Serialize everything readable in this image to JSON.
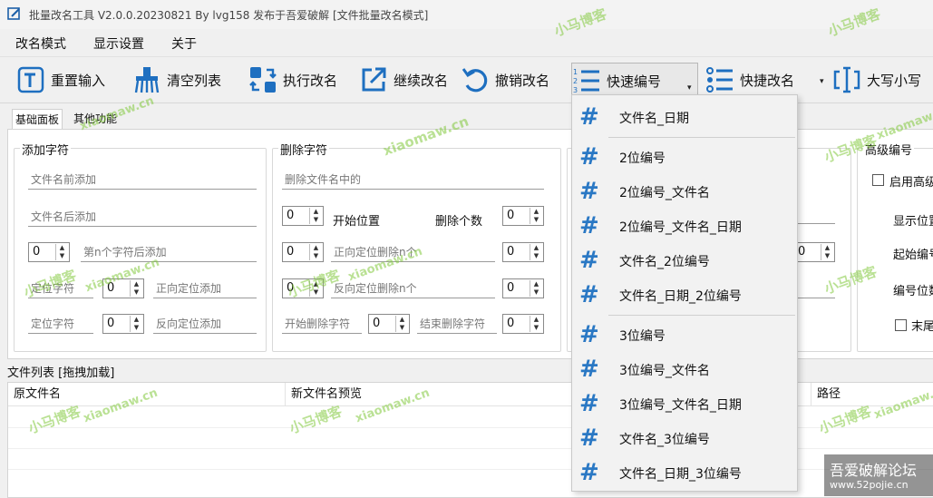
{
  "window": {
    "title": "批量改名工具 V2.0.0.20230821 By lvg158 发布于吾爱破解 [文件批量改名模式]"
  },
  "menu": {
    "items": [
      "改名模式",
      "显示设置",
      "关于"
    ]
  },
  "toolbar": {
    "reset": "重置输入",
    "clear": "清空列表",
    "run": "执行改名",
    "continue": "继续改名",
    "undo": "撤销改名",
    "quick_number": "快速编号",
    "quick_rename": "快捷改名",
    "case": "大写小写"
  },
  "tabs": [
    "基础面板",
    "其他功能"
  ],
  "add_group": {
    "title": "添加字符",
    "prefix_placeholder": "文件名前添加",
    "suffix_placeholder": "文件名后添加",
    "nth_value": "0",
    "nth_placeholder": "第n个字符后添加",
    "locate1_placeholder": "定位字符",
    "locate1_value": "0",
    "forward_placeholder": "正向定位添加",
    "locate2_placeholder": "定位字符",
    "locate2_value": "0",
    "backward_placeholder": "反向定位添加"
  },
  "del_group": {
    "title": "删除字符",
    "in_name_placeholder": "删除文件名中的",
    "start_value": "0",
    "start_label": "开始位置",
    "count_label": "删除个数",
    "count_value": "0",
    "fwd_value": "0",
    "fwd_placeholder": "正向定位删除n个",
    "fwd_n": "0",
    "back_value": "0",
    "back_placeholder": "反向定位删除n个",
    "back_n": "0",
    "start_char_placeholder": "开始删除字符",
    "start_char_value": "0",
    "end_char_placeholder": "结束删除字符",
    "end_char_value": "0"
  },
  "mid_group": {
    "spin_value": "0"
  },
  "adv_group": {
    "title": "高级编号",
    "enable_label": "启用高级",
    "pos_label": "显示位置",
    "start_label": "起始编号",
    "digits_label": "编号位数",
    "tail_label": "末尾"
  },
  "filelist": {
    "label": "文件列表 [拖拽加载]",
    "columns": [
      "原文件名",
      "新文件名预览",
      "路径"
    ]
  },
  "quick_number_menu": {
    "group1": [
      "文件名_日期"
    ],
    "group2": [
      "2位编号",
      "2位编号_文件名",
      "2位编号_文件名_日期",
      "文件名_2位编号",
      "文件名_日期_2位编号"
    ],
    "group3": [
      "3位编号",
      "3位编号_文件名",
      "3位编号_文件名_日期",
      "文件名_3位编号",
      "文件名_日期_3位编号"
    ],
    "icon": "hash-icon"
  },
  "watermark": {
    "site": "xiaomaw.cn",
    "cn": "小马博客",
    "forum": "吾爱破解论坛",
    "forum_url": "www.52pojie.cn"
  },
  "colors": {
    "accent": "#2a78c4",
    "watermark": "#8cc840"
  }
}
